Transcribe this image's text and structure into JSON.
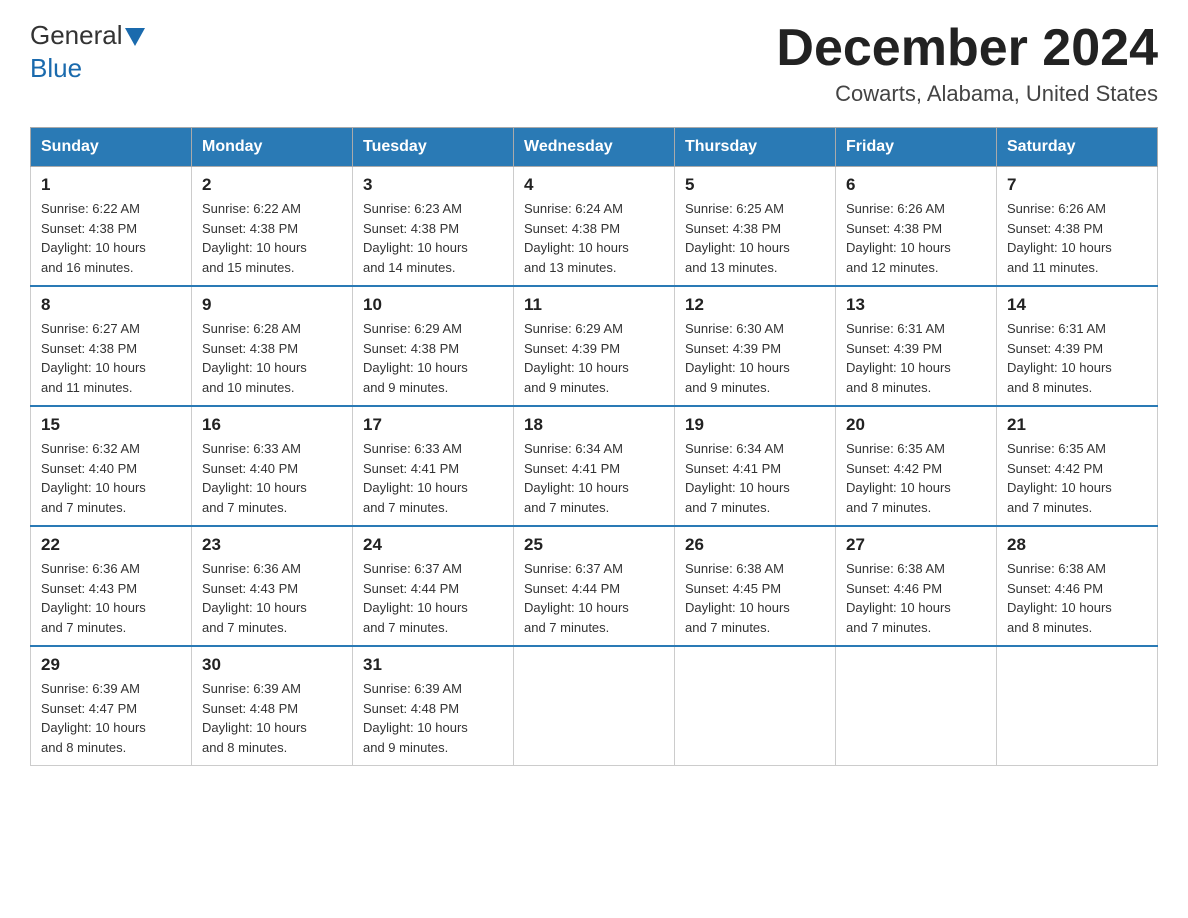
{
  "header": {
    "logo_general": "General",
    "logo_blue": "Blue",
    "month_title": "December 2024",
    "location": "Cowarts, Alabama, United States"
  },
  "weekdays": [
    "Sunday",
    "Monday",
    "Tuesday",
    "Wednesday",
    "Thursday",
    "Friday",
    "Saturday"
  ],
  "weeks": [
    [
      {
        "day": "1",
        "sunrise": "6:22 AM",
        "sunset": "4:38 PM",
        "daylight": "10 hours and 16 minutes."
      },
      {
        "day": "2",
        "sunrise": "6:22 AM",
        "sunset": "4:38 PM",
        "daylight": "10 hours and 15 minutes."
      },
      {
        "day": "3",
        "sunrise": "6:23 AM",
        "sunset": "4:38 PM",
        "daylight": "10 hours and 14 minutes."
      },
      {
        "day": "4",
        "sunrise": "6:24 AM",
        "sunset": "4:38 PM",
        "daylight": "10 hours and 13 minutes."
      },
      {
        "day": "5",
        "sunrise": "6:25 AM",
        "sunset": "4:38 PM",
        "daylight": "10 hours and 13 minutes."
      },
      {
        "day": "6",
        "sunrise": "6:26 AM",
        "sunset": "4:38 PM",
        "daylight": "10 hours and 12 minutes."
      },
      {
        "day": "7",
        "sunrise": "6:26 AM",
        "sunset": "4:38 PM",
        "daylight": "10 hours and 11 minutes."
      }
    ],
    [
      {
        "day": "8",
        "sunrise": "6:27 AM",
        "sunset": "4:38 PM",
        "daylight": "10 hours and 11 minutes."
      },
      {
        "day": "9",
        "sunrise": "6:28 AM",
        "sunset": "4:38 PM",
        "daylight": "10 hours and 10 minutes."
      },
      {
        "day": "10",
        "sunrise": "6:29 AM",
        "sunset": "4:38 PM",
        "daylight": "10 hours and 9 minutes."
      },
      {
        "day": "11",
        "sunrise": "6:29 AM",
        "sunset": "4:39 PM",
        "daylight": "10 hours and 9 minutes."
      },
      {
        "day": "12",
        "sunrise": "6:30 AM",
        "sunset": "4:39 PM",
        "daylight": "10 hours and 9 minutes."
      },
      {
        "day": "13",
        "sunrise": "6:31 AM",
        "sunset": "4:39 PM",
        "daylight": "10 hours and 8 minutes."
      },
      {
        "day": "14",
        "sunrise": "6:31 AM",
        "sunset": "4:39 PM",
        "daylight": "10 hours and 8 minutes."
      }
    ],
    [
      {
        "day": "15",
        "sunrise": "6:32 AM",
        "sunset": "4:40 PM",
        "daylight": "10 hours and 7 minutes."
      },
      {
        "day": "16",
        "sunrise": "6:33 AM",
        "sunset": "4:40 PM",
        "daylight": "10 hours and 7 minutes."
      },
      {
        "day": "17",
        "sunrise": "6:33 AM",
        "sunset": "4:41 PM",
        "daylight": "10 hours and 7 minutes."
      },
      {
        "day": "18",
        "sunrise": "6:34 AM",
        "sunset": "4:41 PM",
        "daylight": "10 hours and 7 minutes."
      },
      {
        "day": "19",
        "sunrise": "6:34 AM",
        "sunset": "4:41 PM",
        "daylight": "10 hours and 7 minutes."
      },
      {
        "day": "20",
        "sunrise": "6:35 AM",
        "sunset": "4:42 PM",
        "daylight": "10 hours and 7 minutes."
      },
      {
        "day": "21",
        "sunrise": "6:35 AM",
        "sunset": "4:42 PM",
        "daylight": "10 hours and 7 minutes."
      }
    ],
    [
      {
        "day": "22",
        "sunrise": "6:36 AM",
        "sunset": "4:43 PM",
        "daylight": "10 hours and 7 minutes."
      },
      {
        "day": "23",
        "sunrise": "6:36 AM",
        "sunset": "4:43 PM",
        "daylight": "10 hours and 7 minutes."
      },
      {
        "day": "24",
        "sunrise": "6:37 AM",
        "sunset": "4:44 PM",
        "daylight": "10 hours and 7 minutes."
      },
      {
        "day": "25",
        "sunrise": "6:37 AM",
        "sunset": "4:44 PM",
        "daylight": "10 hours and 7 minutes."
      },
      {
        "day": "26",
        "sunrise": "6:38 AM",
        "sunset": "4:45 PM",
        "daylight": "10 hours and 7 minutes."
      },
      {
        "day": "27",
        "sunrise": "6:38 AM",
        "sunset": "4:46 PM",
        "daylight": "10 hours and 7 minutes."
      },
      {
        "day": "28",
        "sunrise": "6:38 AM",
        "sunset": "4:46 PM",
        "daylight": "10 hours and 8 minutes."
      }
    ],
    [
      {
        "day": "29",
        "sunrise": "6:39 AM",
        "sunset": "4:47 PM",
        "daylight": "10 hours and 8 minutes."
      },
      {
        "day": "30",
        "sunrise": "6:39 AM",
        "sunset": "4:48 PM",
        "daylight": "10 hours and 8 minutes."
      },
      {
        "day": "31",
        "sunrise": "6:39 AM",
        "sunset": "4:48 PM",
        "daylight": "10 hours and 9 minutes."
      },
      null,
      null,
      null,
      null
    ]
  ],
  "labels": {
    "sunrise": "Sunrise:",
    "sunset": "Sunset:",
    "daylight": "Daylight:"
  }
}
